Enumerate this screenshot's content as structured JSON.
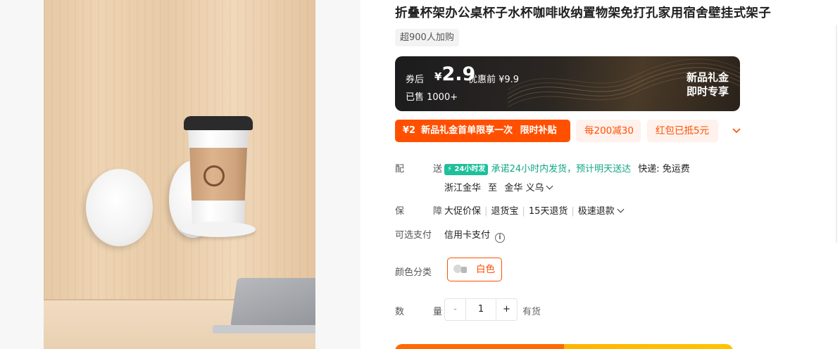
{
  "product": {
    "title": "折叠杯架办公桌杯子水杯咖啡收纳置物架免打孔家用宿舍壁挂式架子",
    "buyers_badge": "超900人加购"
  },
  "price_card": {
    "label": "券后",
    "currency": "¥",
    "price": "2.9",
    "original": "优惠前 ¥9.9",
    "sold": "已售 1000+",
    "new_gift_line1": "新品礼金",
    "new_gift_line2": "即时专享"
  },
  "promotions": {
    "main_amount": "¥2",
    "main_text": "新品礼金首单限享一次",
    "main_tag": "限时补贴",
    "chip1": "每200减30",
    "chip2": "红包已抵5元"
  },
  "delivery": {
    "label": "配　送",
    "badge": "24小时发",
    "promise": "承诺24小时内发货，预计明天送达",
    "courier": "快递: 免运费",
    "from": "浙江金华",
    "to_word": "至",
    "to": "金华 义乌"
  },
  "guarantee": {
    "label": "保　障",
    "items": [
      "大促价保",
      "退货宝",
      "15天退货",
      "极速退款"
    ]
  },
  "payment": {
    "label": "可选支付",
    "value": "信用卡支付"
  },
  "color": {
    "label": "颜色分类",
    "selected": "白色"
  },
  "quantity": {
    "label": "数　量",
    "minus": "-",
    "value": "1",
    "plus": "+",
    "stock": "有货"
  },
  "colors": {
    "accent": "#ff5000",
    "green": "#11a683"
  }
}
